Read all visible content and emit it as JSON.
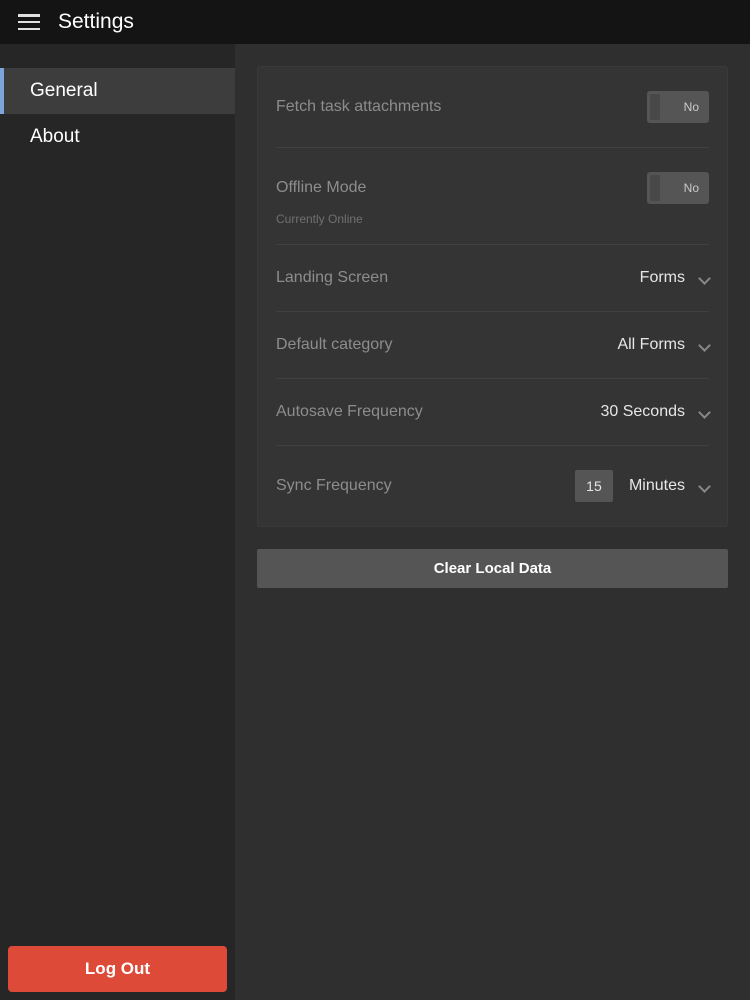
{
  "header": {
    "title": "Settings"
  },
  "sidebar": {
    "items": [
      {
        "label": "General",
        "active": true
      },
      {
        "label": "About",
        "active": false
      }
    ],
    "logout_label": "Log Out"
  },
  "settings": {
    "fetch_attachments": {
      "label": "Fetch task attachments",
      "toggle_value": "No"
    },
    "offline_mode": {
      "label": "Offline Mode",
      "toggle_value": "No",
      "sublabel": "Currently Online"
    },
    "landing_screen": {
      "label": "Landing Screen",
      "value": "Forms"
    },
    "default_category": {
      "label": "Default category",
      "value": "All Forms"
    },
    "autosave_frequency": {
      "label": "Autosave Frequency",
      "value": "30 Seconds"
    },
    "sync_frequency": {
      "label": "Sync Frequency",
      "input_value": "15",
      "unit": "Minutes"
    }
  },
  "clear_data_label": "Clear Local Data"
}
